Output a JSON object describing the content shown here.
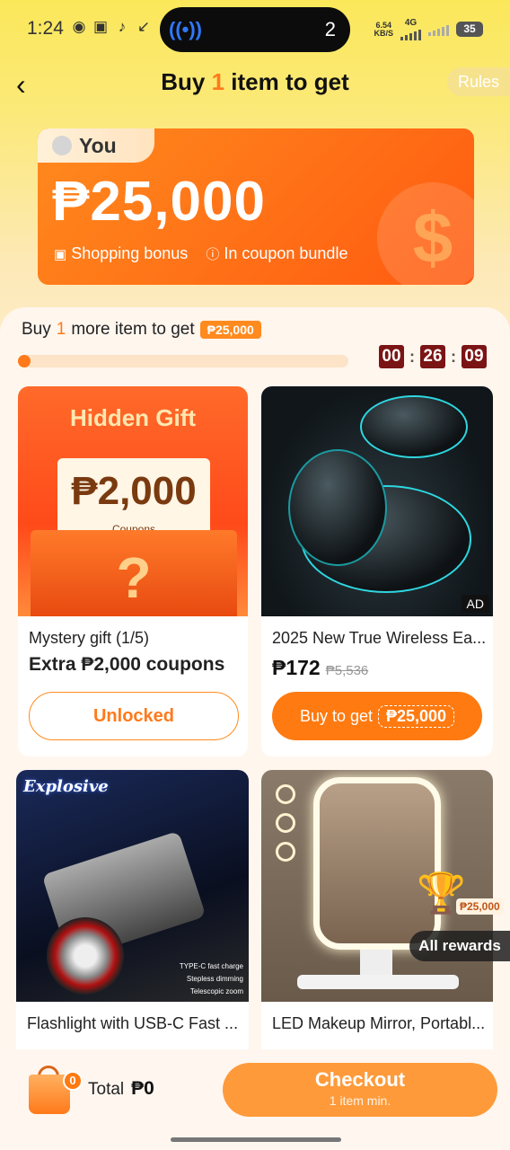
{
  "status_bar": {
    "time": "1:24",
    "island_count": "2",
    "net_speed_value": "6.54",
    "net_speed_unit": "KB/S",
    "network": "4G",
    "battery": "35"
  },
  "header": {
    "title_prefix": "Buy ",
    "title_number": "1",
    "title_suffix": " item to get",
    "rules_label": "Rules"
  },
  "hero": {
    "you_label": "You",
    "amount": "₱25,000",
    "shopping_bonus_label": "Shopping bonus",
    "coupon_bundle_label": "In coupon bundle"
  },
  "progress": {
    "text_prefix": "Buy",
    "text_number": "1",
    "text_suffix": "more item to get",
    "reward_amount": "₱25,000",
    "fraction_complete": 0.0,
    "timer": {
      "hours": "00",
      "minutes": "26",
      "seconds": "09"
    }
  },
  "products": [
    {
      "image_title": "Hidden Gift",
      "image_amount": "₱2,000",
      "image_sub": "Coupons",
      "title": "Mystery gift (1/5)",
      "subtitle": "Extra ₱2,000 coupons",
      "button_label": "Unlocked"
    },
    {
      "title": "2025 New True Wireless Ea...",
      "price": "₱172",
      "old_price": "₱5,536",
      "ad_label": "AD",
      "button_prefix": "Buy to get",
      "button_amount": "₱25,000"
    },
    {
      "image_badge": "Explosive",
      "features": [
        "TYPE-C fast charge",
        "Stepless dimming",
        "Telescopic zoom"
      ],
      "title": "Flashlight with USB-C Fast ..."
    },
    {
      "title": "LED Makeup Mirror, Portabl..."
    }
  ],
  "rewards": {
    "amount": "₱25,000",
    "label": "All rewards"
  },
  "bottom_bar": {
    "cart_count": "0",
    "total_label": "Total",
    "total_value": "₱0",
    "checkout_label": "Checkout",
    "checkout_sub": "1 item min."
  }
}
